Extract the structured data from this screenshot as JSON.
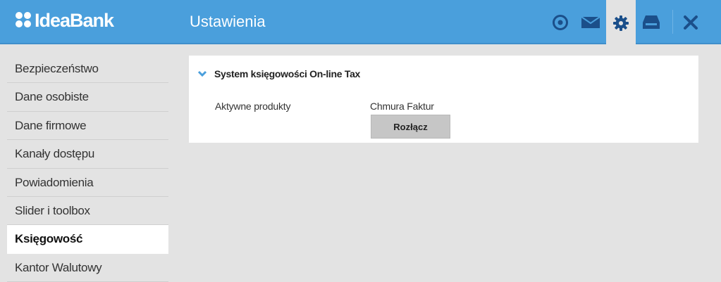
{
  "header": {
    "logo_text": "IdeaBank",
    "title": "Ustawienia",
    "icons": [
      "target-icon",
      "mail-icon",
      "gear-icon",
      "inbox-icon",
      "close-icon"
    ],
    "accent_color": "#4a9fdc"
  },
  "sidebar": {
    "items": [
      {
        "label": "Bezpieczeństwo"
      },
      {
        "label": "Dane osobiste"
      },
      {
        "label": "Dane firmowe"
      },
      {
        "label": "Kanały dostępu"
      },
      {
        "label": "Powiadomienia"
      },
      {
        "label": "Slider i toolbox"
      },
      {
        "label": "Księgowość",
        "active": true
      },
      {
        "label": "Kantor Walutowy"
      }
    ]
  },
  "panel": {
    "title": "System księgowości On-line Tax",
    "label": "Aktywne produkty",
    "value": "Chmura Faktur",
    "button_label": "Rozłącz"
  }
}
